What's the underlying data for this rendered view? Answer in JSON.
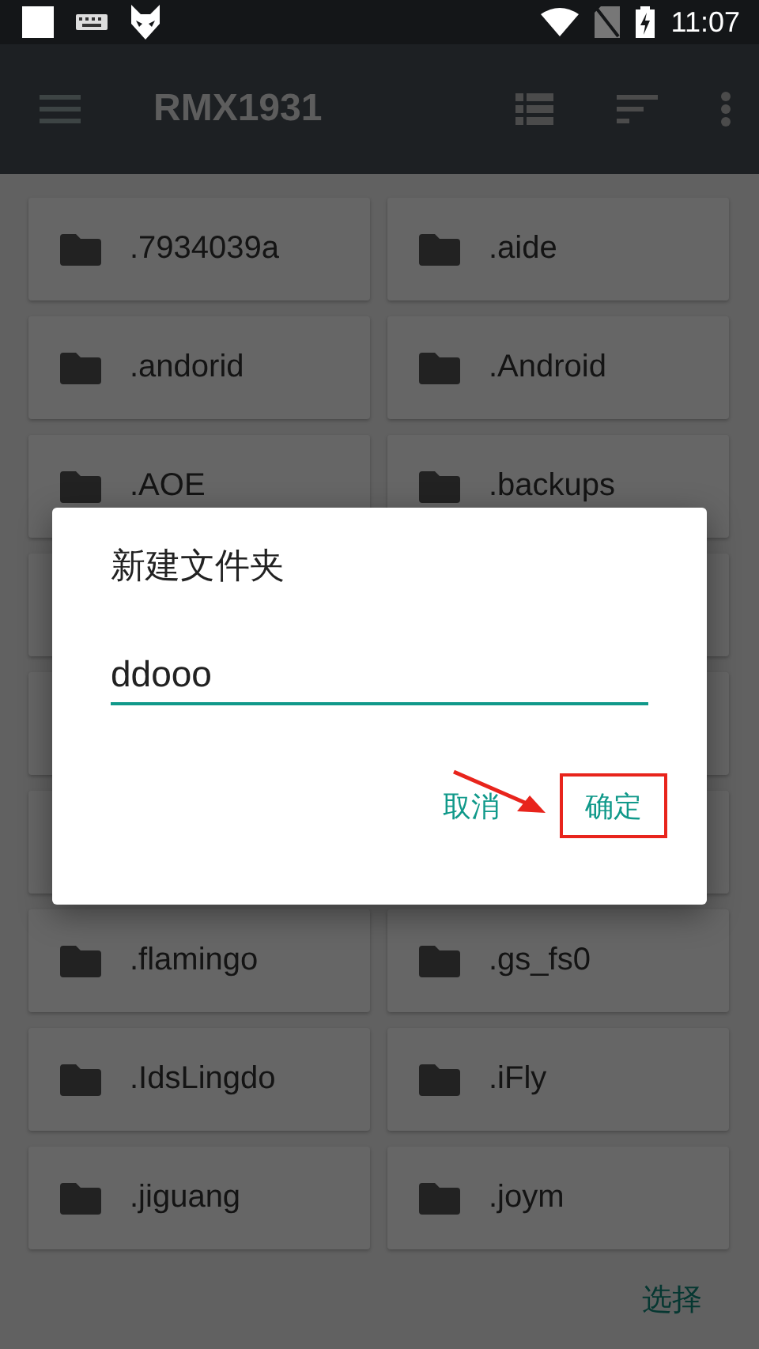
{
  "status_bar": {
    "time": "11:07"
  },
  "toolbar": {
    "title": "RMX1931"
  },
  "folders": [
    {
      "name": ".7934039a"
    },
    {
      "name": ".aide"
    },
    {
      "name": ".andorid"
    },
    {
      "name": ".Android"
    },
    {
      "name": ".AOE"
    },
    {
      "name": ".backups"
    },
    {
      "name": ".flamingo"
    },
    {
      "name": ".gs_fs0"
    },
    {
      "name": ".IdsLingdo"
    },
    {
      "name": ".iFly"
    },
    {
      "name": ".jiguang"
    },
    {
      "name": ".joym"
    }
  ],
  "dialog": {
    "title": "新建文件夹",
    "input_value": "ddooo",
    "buttons": [
      {
        "label": "取消",
        "highlighted": false
      },
      {
        "label": "确定",
        "highlighted": true
      }
    ]
  },
  "bottom_bar": {
    "action": "选择"
  }
}
